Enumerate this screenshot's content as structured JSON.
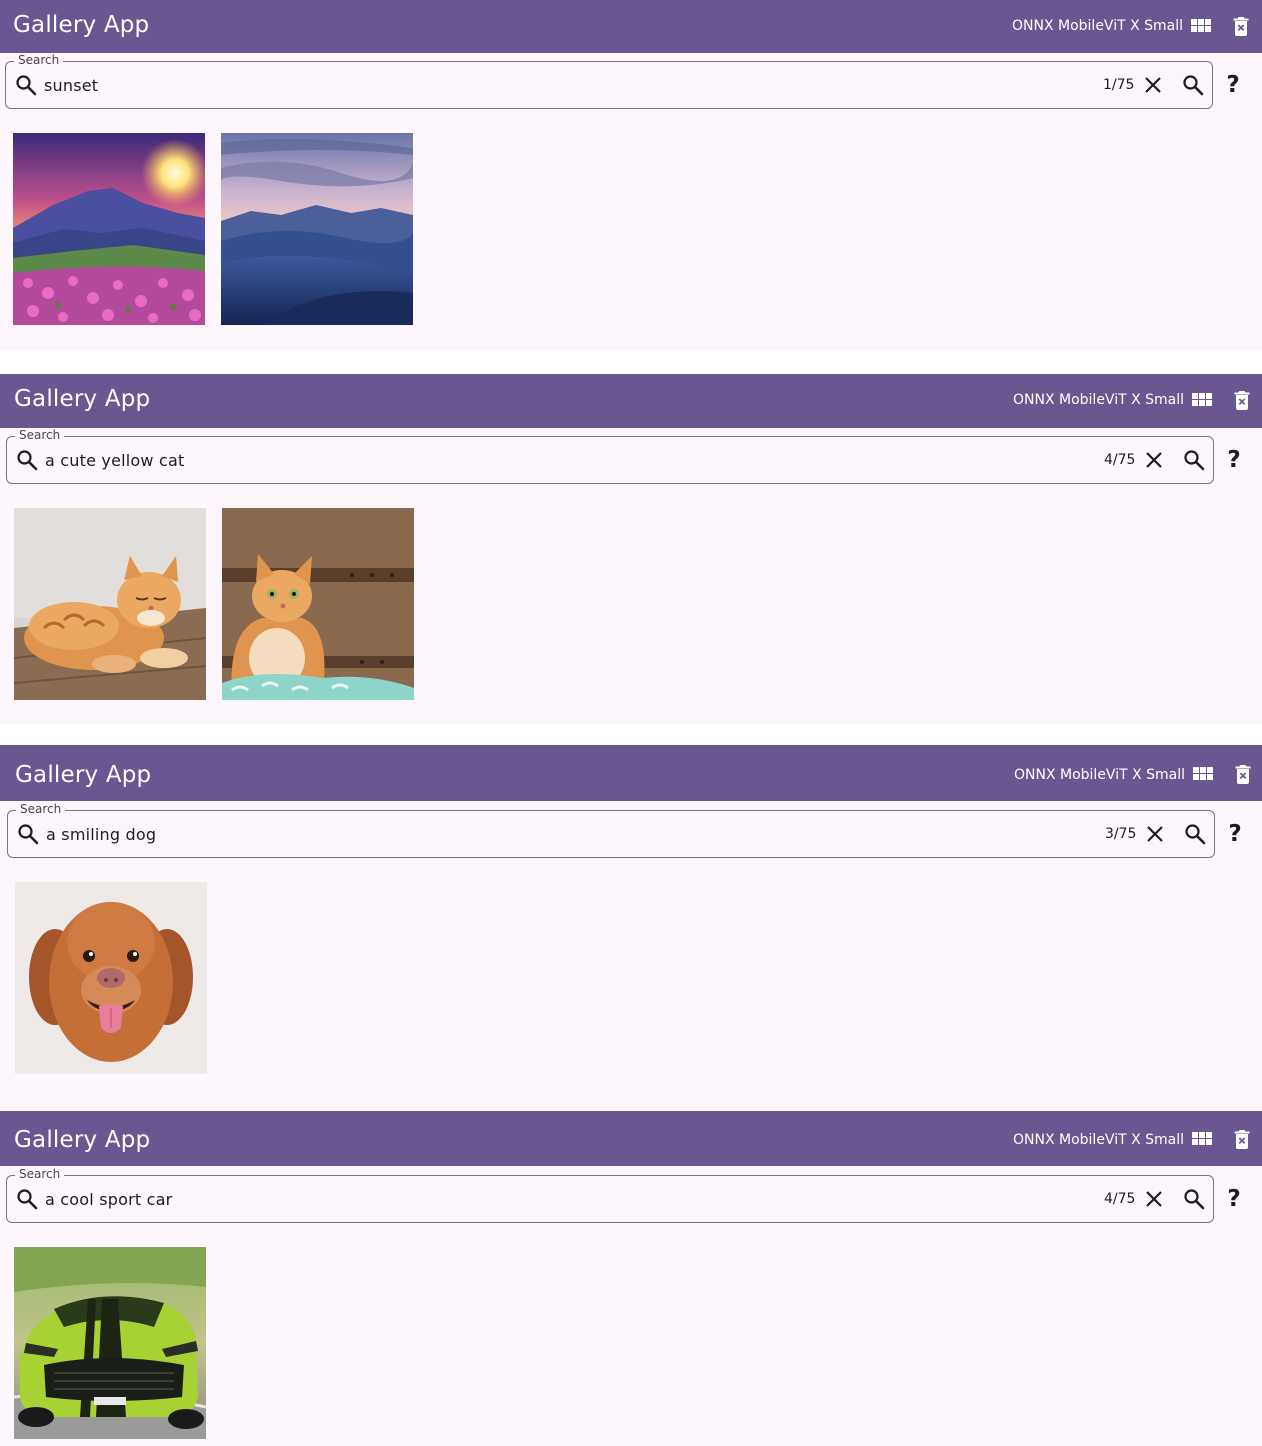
{
  "app": {
    "title": "Gallery App",
    "model": "ONNX MobileViT X Small",
    "search_label": "Search",
    "help_glyph": "?",
    "colors": {
      "appbar": "#6a5791",
      "background": "#fdf6fd",
      "outline": "#7a7480"
    },
    "icons": {
      "grid": "grid-view-icon",
      "delete": "delete-icon",
      "search": "search-icon",
      "clear": "close-icon",
      "help": "help-icon"
    }
  },
  "screens": [
    {
      "query": "sunset",
      "counter": "1/75",
      "results": [
        "sunset-mountain-flowers-image",
        "desert-dunes-dusk-image"
      ]
    },
    {
      "query": "a cute yellow cat",
      "counter": "4/75",
      "results": [
        "orange-cat-lying-image",
        "orange-cat-sitting-image"
      ]
    },
    {
      "query": "a smiling dog",
      "counter": "3/75",
      "results": [
        "smiling-dog-image"
      ]
    },
    {
      "query": "a cool sport car",
      "counter": "4/75",
      "results": [
        "green-sport-car-image"
      ]
    }
  ]
}
